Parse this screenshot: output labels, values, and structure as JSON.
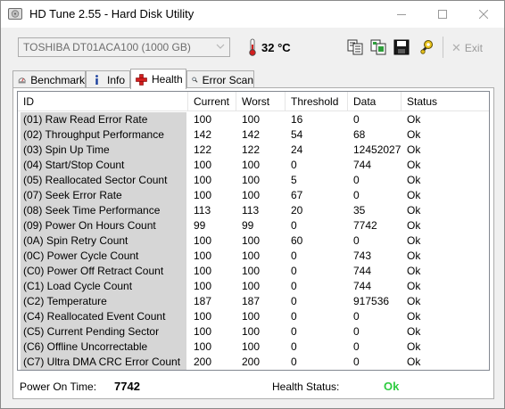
{
  "window": {
    "title": "HD Tune 2.55 - Hard Disk Utility"
  },
  "toolbar": {
    "drive": "TOSHIBA DT01ACA100 (1000 GB)",
    "temperature": "32 °C",
    "exit_label": "Exit",
    "icons": [
      "copy-icon",
      "copy-screenshot-icon",
      "save-icon",
      "options-icon",
      "exit-icon"
    ]
  },
  "tabs": [
    {
      "label": "Benchmark",
      "icon": "benchmark-icon",
      "active": false
    },
    {
      "label": "Info",
      "icon": "info-icon",
      "active": false
    },
    {
      "label": "Health",
      "icon": "health-cross-icon",
      "active": true
    },
    {
      "label": "Error Scan",
      "icon": "magnifier-icon",
      "active": false
    }
  ],
  "table": {
    "columns": [
      "ID",
      "Current",
      "Worst",
      "Threshold",
      "Data",
      "Status"
    ],
    "rows": [
      {
        "id": "(01) Raw Read Error Rate",
        "current": "100",
        "worst": "100",
        "threshold": "16",
        "data": "0",
        "status": "Ok"
      },
      {
        "id": "(02) Throughput Performance",
        "current": "142",
        "worst": "142",
        "threshold": "54",
        "data": "68",
        "status": "Ok"
      },
      {
        "id": "(03) Spin Up Time",
        "current": "122",
        "worst": "122",
        "threshold": "24",
        "data": "12452027",
        "status": "Ok"
      },
      {
        "id": "(04) Start/Stop Count",
        "current": "100",
        "worst": "100",
        "threshold": "0",
        "data": "744",
        "status": "Ok"
      },
      {
        "id": "(05) Reallocated Sector Count",
        "current": "100",
        "worst": "100",
        "threshold": "5",
        "data": "0",
        "status": "Ok"
      },
      {
        "id": "(07) Seek Error Rate",
        "current": "100",
        "worst": "100",
        "threshold": "67",
        "data": "0",
        "status": "Ok"
      },
      {
        "id": "(08) Seek Time Performance",
        "current": "113",
        "worst": "113",
        "threshold": "20",
        "data": "35",
        "status": "Ok"
      },
      {
        "id": "(09) Power On Hours Count",
        "current": "99",
        "worst": "99",
        "threshold": "0",
        "data": "7742",
        "status": "Ok"
      },
      {
        "id": "(0A) Spin Retry Count",
        "current": "100",
        "worst": "100",
        "threshold": "60",
        "data": "0",
        "status": "Ok"
      },
      {
        "id": "(0C) Power Cycle Count",
        "current": "100",
        "worst": "100",
        "threshold": "0",
        "data": "743",
        "status": "Ok"
      },
      {
        "id": "(C0) Power Off Retract Count",
        "current": "100",
        "worst": "100",
        "threshold": "0",
        "data": "744",
        "status": "Ok"
      },
      {
        "id": "(C1) Load Cycle Count",
        "current": "100",
        "worst": "100",
        "threshold": "0",
        "data": "744",
        "status": "Ok"
      },
      {
        "id": "(C2) Temperature",
        "current": "187",
        "worst": "187",
        "threshold": "0",
        "data": "917536",
        "status": "Ok"
      },
      {
        "id": "(C4) Reallocated Event Count",
        "current": "100",
        "worst": "100",
        "threshold": "0",
        "data": "0",
        "status": "Ok"
      },
      {
        "id": "(C5) Current Pending Sector",
        "current": "100",
        "worst": "100",
        "threshold": "0",
        "data": "0",
        "status": "Ok"
      },
      {
        "id": "(C6) Offline Uncorrectable",
        "current": "100",
        "worst": "100",
        "threshold": "0",
        "data": "0",
        "status": "Ok"
      },
      {
        "id": "(C7) Ultra DMA CRC Error Count",
        "current": "200",
        "worst": "200",
        "threshold": "0",
        "data": "0",
        "status": "Ok"
      }
    ]
  },
  "footer": {
    "power_on_label": "Power On Time:",
    "power_on_value": "7742",
    "health_label": "Health Status:",
    "health_value": "Ok",
    "health_color": "#2ecc40"
  }
}
